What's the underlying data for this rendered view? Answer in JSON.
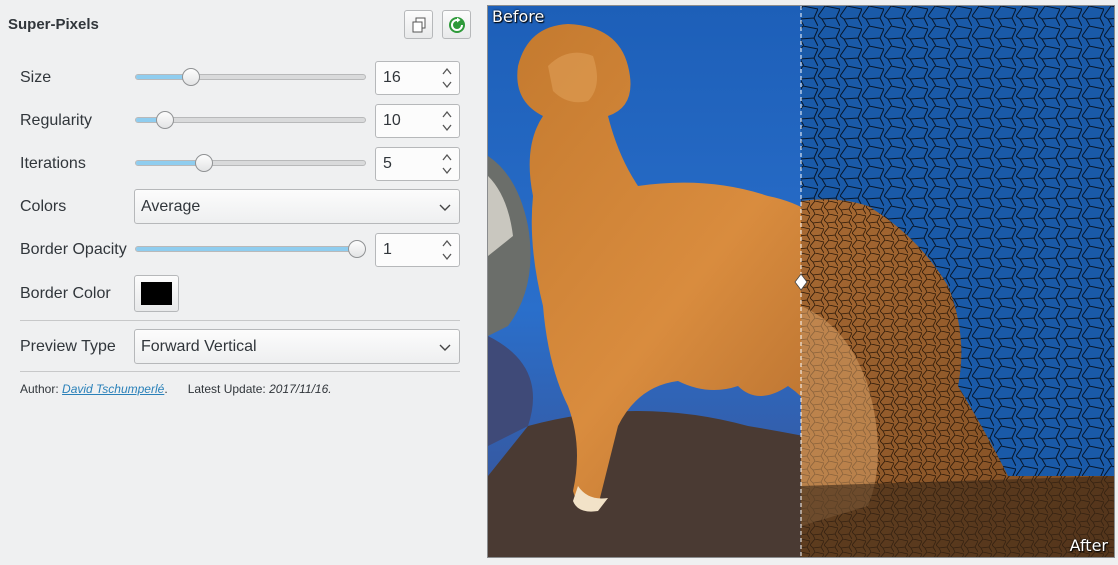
{
  "panel": {
    "title": "Super-Pixels",
    "copy_button_icon": "copy-icon",
    "refresh_button_icon": "refresh-icon"
  },
  "params": {
    "size": {
      "label": "Size",
      "value": "16",
      "fraction": 0.22
    },
    "regularity": {
      "label": "Regularity",
      "value": "10",
      "fraction": 0.1
    },
    "iterations": {
      "label": "Iterations",
      "value": "5",
      "fraction": 0.28
    },
    "colors": {
      "label": "Colors",
      "value": "Average"
    },
    "border_opacity": {
      "label": "Border Opacity",
      "value": "1",
      "fraction": 1.0
    },
    "border_color": {
      "label": "Border Color",
      "color": "#000000"
    },
    "preview_type": {
      "label": "Preview Type",
      "value": "Forward Vertical"
    }
  },
  "footer": {
    "author_label": "Author:",
    "author_name": "David Tschumperlé",
    "author_suffix": ".",
    "update_label": "Latest Update:",
    "update_date": "2017/11/16."
  },
  "preview": {
    "before_label": "Before",
    "after_label": "After",
    "split_fraction": 0.5
  },
  "colors": {
    "accent": "#8fcdef",
    "link": "#2980b9",
    "background": "#eff0f1"
  }
}
